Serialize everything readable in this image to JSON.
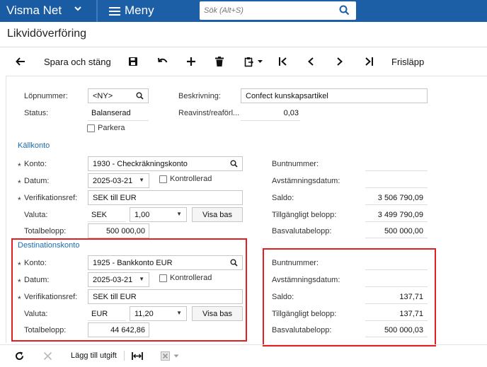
{
  "app": {
    "brand": "Visma Net",
    "menu_label": "Meny"
  },
  "search": {
    "placeholder": "Sök (Alt+S)"
  },
  "page": {
    "title": "Likvidöverföring"
  },
  "toolbar": {
    "save_close": "Spara och stäng",
    "release": "Frisläpp"
  },
  "header": {
    "number_label": "Löpnummer:",
    "number_value": "<NY>",
    "status_label": "Status:",
    "status_value": "Balanserad",
    "hold_label": "Parkera",
    "description_label": "Beskrivning:",
    "description_value": "Confect kunskapsartikel",
    "rga_label": "Reavinst/reaförl...",
    "rga_value": "0,03"
  },
  "source": {
    "section_title": "Källkonto",
    "account_label": "Konto:",
    "account_value": "1930 - Checkräkningskonto",
    "date_label": "Datum:",
    "date_value": "2025-03-21",
    "cleared_label": "Kontrollerad",
    "ref_label": "Verifikationsref:",
    "ref_value": "SEK till EUR",
    "currency_label": "Valuta:",
    "currency_value": "SEK",
    "rate_value": "1,00",
    "view_base": "Visa bas",
    "total_label": "Totalbelopp:",
    "total_value": "500 000,00",
    "batch_label": "Buntnummer:",
    "batch_value": "",
    "recon_label": "Avstämningsdatum:",
    "recon_value": "",
    "balance_label": "Saldo:",
    "balance_value": "3 506 790,09",
    "available_label": "Tillgängligt belopp:",
    "available_value": "3 499 790,09",
    "base_label": "Basvalutabelopp:",
    "base_value": "500 000,00"
  },
  "destination": {
    "section_title": "Destinationskonto",
    "account_label": "Konto:",
    "account_value": "1925 - Bankkonto EUR",
    "date_label": "Datum:",
    "date_value": "2025-03-21",
    "cleared_label": "Kontrollerad",
    "ref_label": "Verifikationsref:",
    "ref_value": "SEK till EUR",
    "currency_label": "Valuta:",
    "currency_value": "EUR",
    "rate_value": "11,20",
    "view_base": "Visa bas",
    "total_label": "Totalbelopp:",
    "total_value": "44 642,86",
    "batch_label": "Buntnummer:",
    "batch_value": "",
    "recon_label": "Avstämningsdatum:",
    "recon_value": "",
    "balance_label": "Saldo:",
    "balance_value": "137,71",
    "available_label": "Tillgängligt belopp:",
    "available_value": "137,71",
    "base_label": "Basvalutabelopp:",
    "base_value": "500 000,03"
  },
  "bottom": {
    "add_expense": "Lägg till utgift"
  },
  "colors": {
    "topbar": "#1c5fa6",
    "highlight": "#e02020",
    "link": "#1a6bb0"
  }
}
